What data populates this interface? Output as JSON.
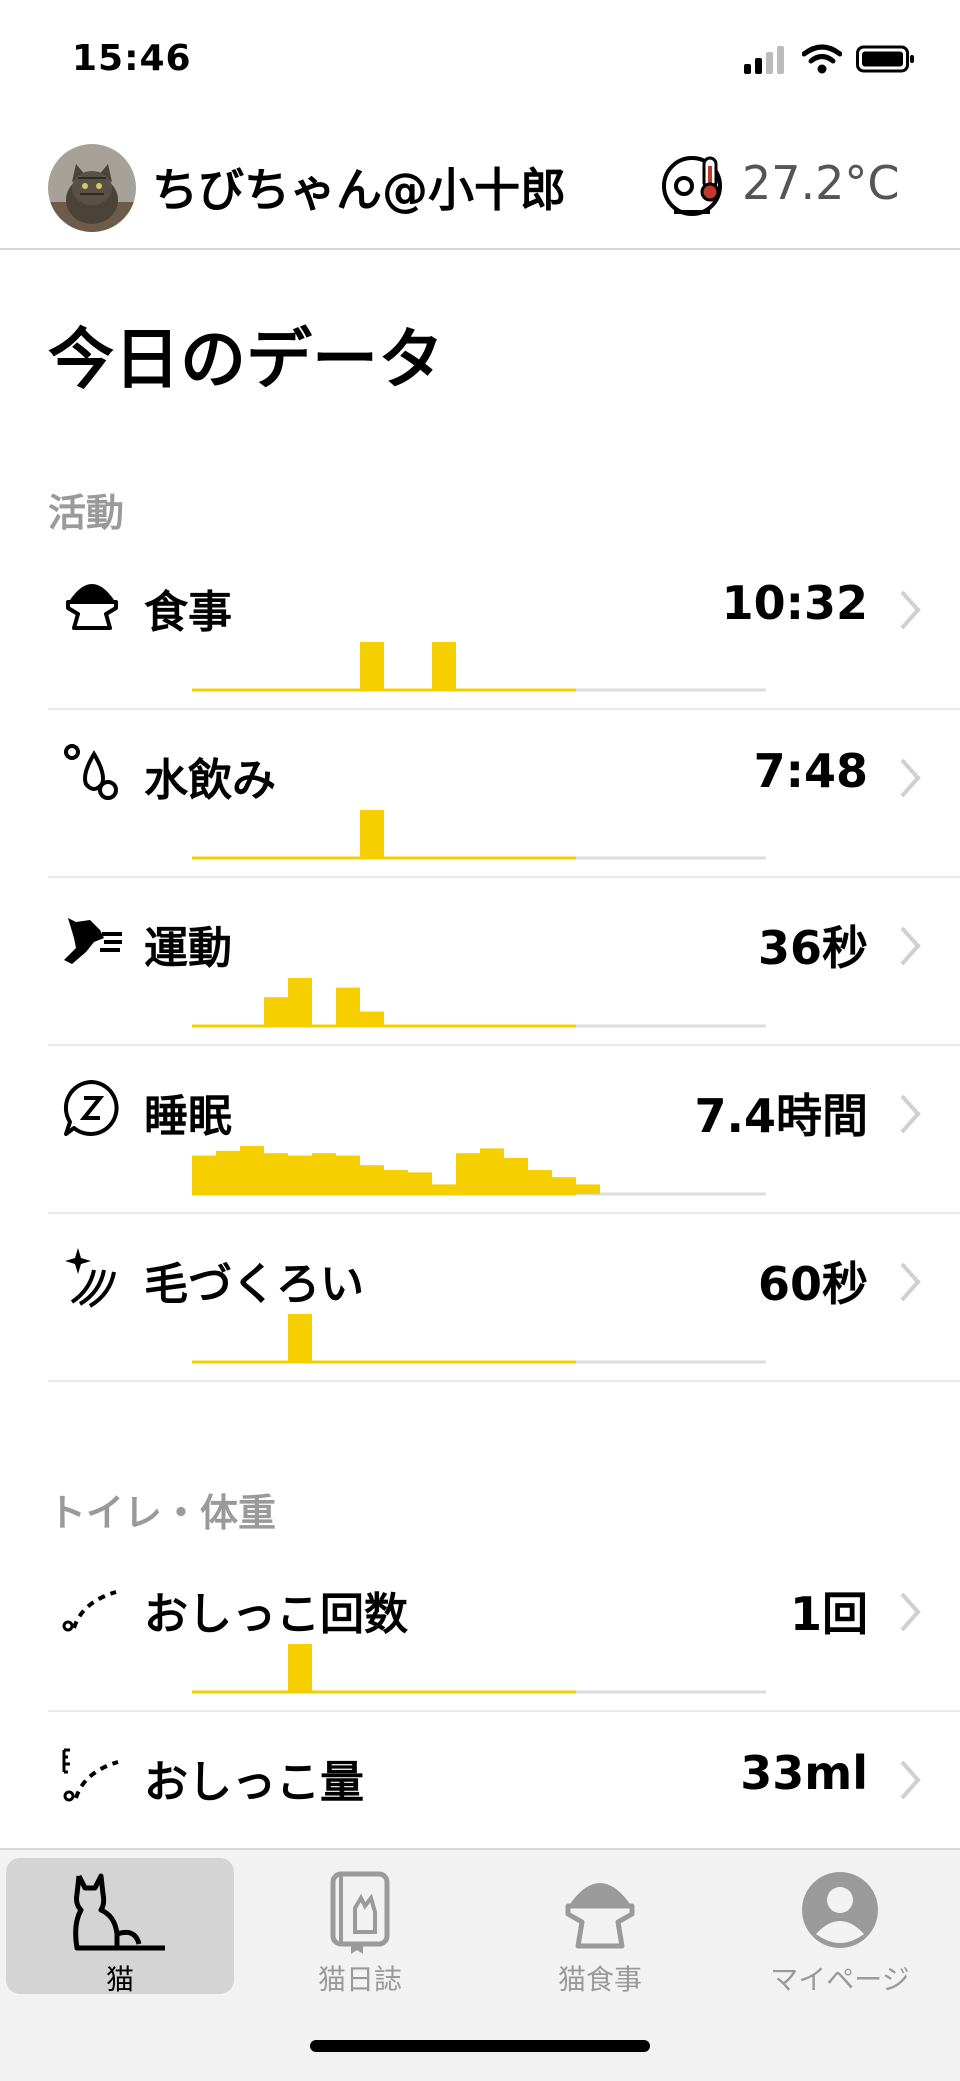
{
  "status": {
    "time": "15:46"
  },
  "header": {
    "cat_name": "ちびちゃん@小十郎",
    "temperature": "27.2°C"
  },
  "page_title": "今日のデータ",
  "sections": {
    "activity": "活動",
    "toilet": "トイレ・体重"
  },
  "rows": [
    {
      "id": "meal",
      "label": "食事",
      "value": "10:32",
      "icon": "food-bowl-icon",
      "bars": [
        0,
        0,
        0,
        0,
        0,
        0,
        0,
        1,
        0,
        0,
        1,
        0,
        0,
        0,
        0,
        0,
        0,
        0,
        0,
        0,
        0,
        0,
        0,
        0
      ]
    },
    {
      "id": "water",
      "label": "水飲み",
      "value": "7:48",
      "icon": "water-drops-icon",
      "bars": [
        0,
        0,
        0,
        0,
        0,
        0,
        0,
        1,
        0,
        0,
        0,
        0,
        0,
        0,
        0,
        0,
        0,
        0,
        0,
        0,
        0,
        0,
        0,
        0
      ]
    },
    {
      "id": "exercise",
      "label": "運動",
      "value": "36秒",
      "icon": "running-cat-icon",
      "bars": [
        0,
        0,
        0,
        0.6,
        1,
        0,
        0.8,
        0.3,
        0,
        0,
        0,
        0,
        0,
        0,
        0,
        0,
        0,
        0,
        0,
        0,
        0,
        0,
        0,
        0
      ]
    },
    {
      "id": "sleep",
      "label": "睡眠",
      "value": "7.4時間",
      "icon": "sleep-z-icon",
      "bars": [
        0.8,
        0.9,
        1,
        0.85,
        0.8,
        0.85,
        0.8,
        0.6,
        0.5,
        0.45,
        0.2,
        0.85,
        0.95,
        0.75,
        0.5,
        0.35,
        0.2,
        0,
        0,
        0,
        0,
        0,
        0,
        0
      ]
    },
    {
      "id": "grooming",
      "label": "毛づくろい",
      "value": "60秒",
      "icon": "grooming-sparkle-icon",
      "bars": [
        0,
        0,
        0,
        0,
        1,
        0,
        0,
        0,
        0,
        0,
        0,
        0,
        0,
        0,
        0,
        0,
        0,
        0,
        0,
        0,
        0,
        0,
        0,
        0
      ]
    },
    {
      "id": "pee_count",
      "label": "おしっこ回数",
      "value": "1回",
      "icon": "pee-count-icon",
      "bars": [
        0,
        0,
        0,
        0,
        1,
        0,
        0,
        0,
        0,
        0,
        0,
        0,
        0,
        0,
        0,
        0,
        0,
        0,
        0,
        0,
        0,
        0,
        0,
        0
      ]
    },
    {
      "id": "pee_volume",
      "label": "おしっこ量",
      "value": "33ml",
      "icon": "pee-volume-icon",
      "bars": []
    }
  ],
  "tabs": [
    {
      "label": "猫",
      "icon": "cat-icon",
      "active": true
    },
    {
      "label": "猫日誌",
      "icon": "diary-icon",
      "active": false
    },
    {
      "label": "猫食事",
      "icon": "food-bowl-icon",
      "active": false
    },
    {
      "label": "マイページ",
      "icon": "user-icon",
      "active": false
    }
  ],
  "colors": {
    "accent": "#F5CF00",
    "baseline": "#DDDDDD",
    "muted": "#9A9A9A"
  }
}
